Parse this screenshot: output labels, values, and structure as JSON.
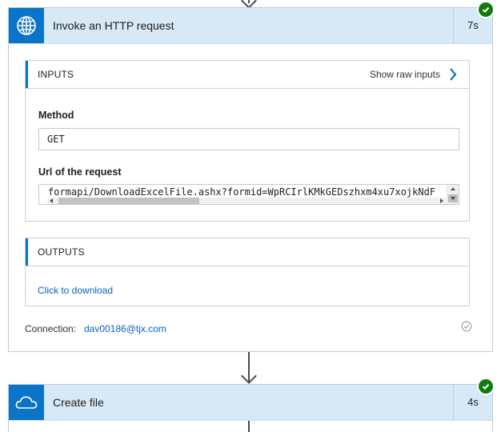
{
  "step1": {
    "title": "Invoke an HTTP request",
    "duration": "7s",
    "icon": "globe-icon",
    "tile_color": "#0a74c8",
    "status": "succeeded",
    "inputs": {
      "label": "INPUTS",
      "show_raw_label": "Show raw inputs",
      "method_label": "Method",
      "method_value": "GET",
      "url_label": "Url of the request",
      "url_value": "formapi/DownloadExcelFile.ashx?formid=WpRCIrlKMkGEDszhxm4xu7xojkNdF"
    },
    "outputs": {
      "label": "OUTPUTS",
      "download_link": "Click to download"
    },
    "connection_label": "Connection:",
    "connection_value": "dav00186@tjx.com"
  },
  "step2": {
    "title": "Create file",
    "duration": "4s",
    "icon": "onedrive-cloud-icon",
    "tile_color": "#0a74c8",
    "status": "succeeded"
  },
  "colors": {
    "header_bg": "#d7e9f6",
    "accent": "#0a74c8",
    "success": "#107c10",
    "link": "#0a62c2"
  }
}
